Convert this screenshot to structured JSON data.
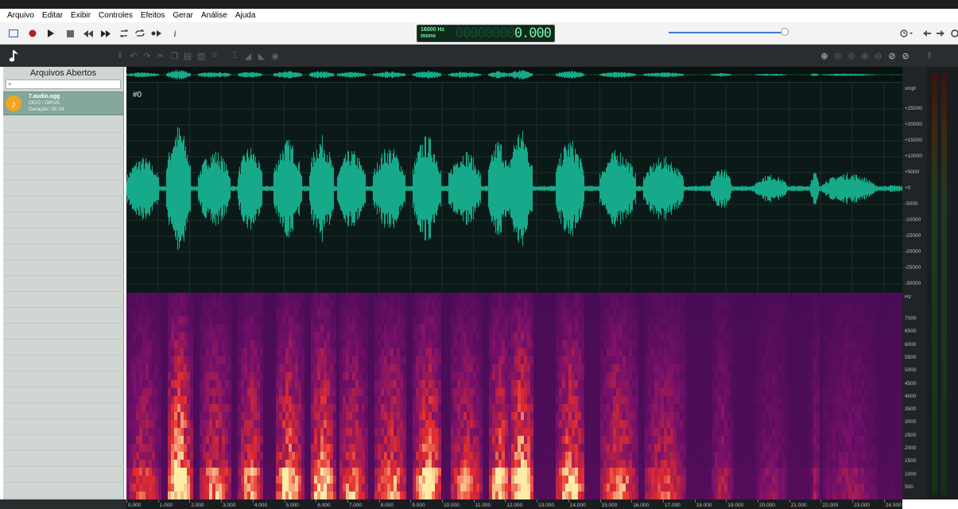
{
  "menu": [
    "Arquivo",
    "Editar",
    "Exibir",
    "Controles",
    "Efeitos",
    "Gerar",
    "Análise",
    "Ajuda"
  ],
  "toolbar": {
    "icons": [
      "selection-icon",
      "record-icon",
      "play-icon",
      "stop-icon",
      "rewind-icon",
      "fast-forward-icon",
      "loop-icon",
      "repeat-icon",
      "play-to-cursor-icon",
      "info-icon"
    ],
    "info_label": "i"
  },
  "display": {
    "rate": "16000 Hz",
    "channels": "mono",
    "time_dim": "00000000",
    "time_lit": "0.000"
  },
  "sidebar": {
    "title": "Arquivos Abertos",
    "search_placeholder": "",
    "file": {
      "name": "7.audio.ogg",
      "format": "OGG / OPUS",
      "duration": "Duração: 00:24"
    }
  },
  "track": {
    "label": "#0"
  },
  "amplitude_axis": {
    "unit": "smpl",
    "labels": [
      "+25000",
      "+20000",
      "+15000",
      "+10000",
      "+5000",
      "+0",
      "-5000",
      "-10000",
      "-15000",
      "-20000",
      "-25000",
      "-30000"
    ]
  },
  "frequency_axis": {
    "unit": "Hz",
    "labels": [
      "7000",
      "6500",
      "6000",
      "5500",
      "5000",
      "4500",
      "4000",
      "3500",
      "3000",
      "2500",
      "2000",
      "1500",
      "1000",
      "500"
    ]
  },
  "timeline": {
    "labels": [
      "0.000",
      "1.000",
      "2.000",
      "3.000",
      "4.000",
      "5.000",
      "6.000",
      "7.000",
      "8.000",
      "9.000",
      "10.000",
      "11.000",
      "12.000",
      "13.000",
      "14.000",
      "15.000",
      "16.000",
      "17.000",
      "18.000",
      "19.000",
      "20.000",
      "21.000",
      "22.000",
      "23.000",
      "24.000"
    ]
  },
  "colors": {
    "waveform": "#16a98a",
    "wave_bg": "#0b1a18",
    "accent": "#3a7fd8",
    "lcd_text": "#7ef0a9"
  }
}
